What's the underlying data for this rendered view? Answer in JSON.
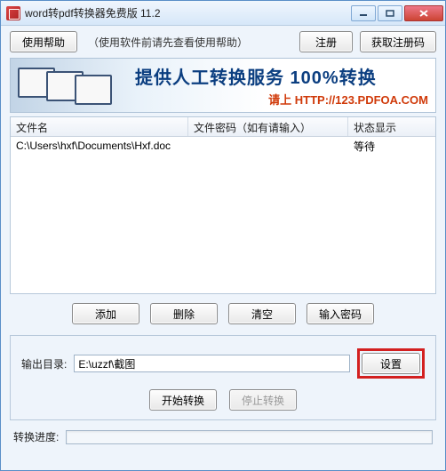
{
  "window": {
    "title": "word转pdf转换器免费版 11.2"
  },
  "toolbar": {
    "help_label": "使用帮助",
    "hint": "（使用软件前请先查看使用帮助）",
    "register_label": "注册",
    "get_code_label": "获取注册码"
  },
  "banner": {
    "line1": "提供人工转换服务 100%转换",
    "line2_prefix": "请上 ",
    "line2_url": "HTTP://123.PDFOA.COM"
  },
  "table": {
    "headers": {
      "filename": "文件名",
      "password": "文件密码（如有请输入）",
      "status": "状态显示"
    },
    "rows": [
      {
        "filename": "C:\\Users\\hxf\\Documents\\Hxf.doc",
        "password": "",
        "status": "等待"
      }
    ]
  },
  "actions": {
    "add": "添加",
    "delete": "删除",
    "clear": "清空",
    "input_password": "输入密码"
  },
  "output": {
    "label": "输出目录:",
    "path": "E:\\uzzf\\截图",
    "set_btn": "设置"
  },
  "convert": {
    "start": "开始转换",
    "stop": "停止转换"
  },
  "progress": {
    "label": "转换进度:"
  }
}
